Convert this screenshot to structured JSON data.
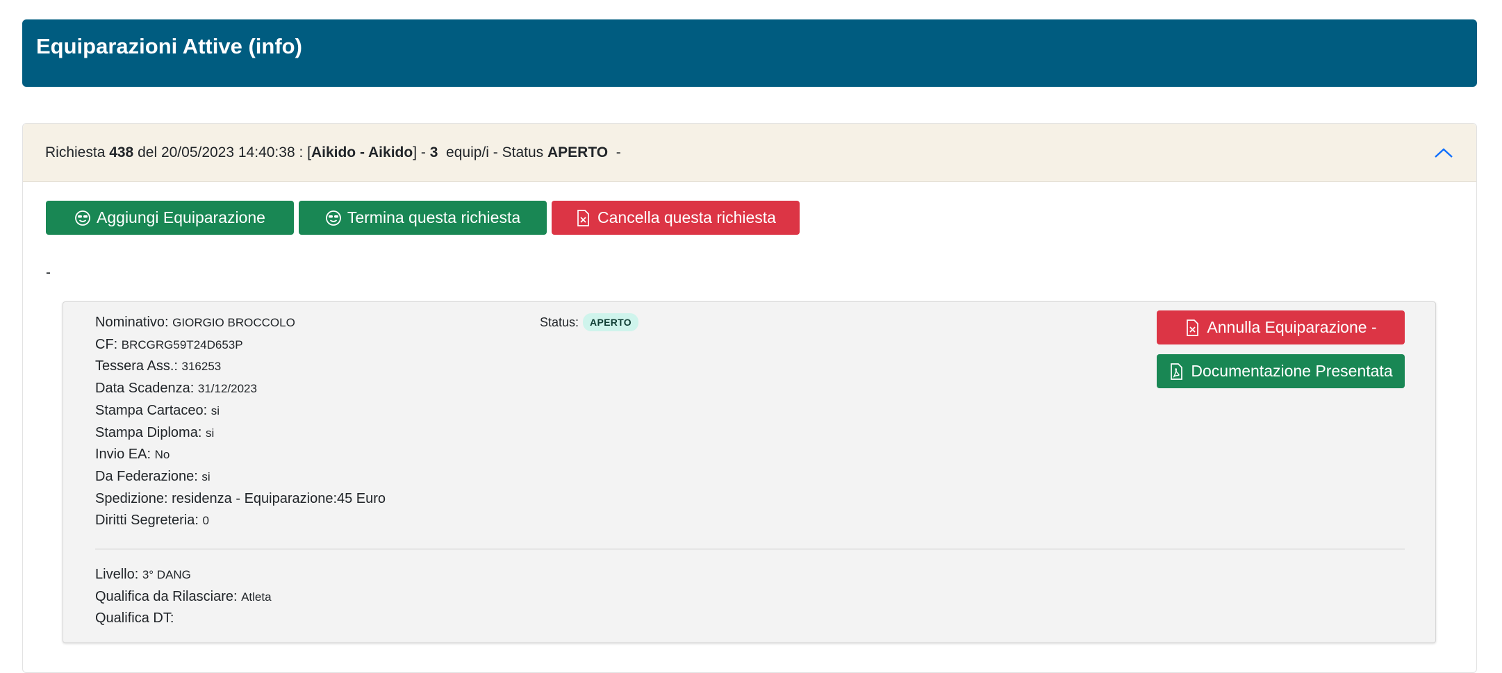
{
  "header": {
    "title": "Equiparazioni Attive (info)"
  },
  "request": {
    "prefix": "Richiesta ",
    "number": "438",
    "date_text": " del 20/05/2023 14:40:38 : [",
    "discipline": "Aikido - Aikido",
    "after_discipline": "] - ",
    "count": "3",
    "count_suffix": "  equip/i - Status ",
    "status": "APERTO",
    "trailing": "  -"
  },
  "actions": {
    "add_label": "Aggiungi Equiparazione",
    "end_label": "Termina questa richiesta",
    "cancel_label": "Cancella questa richiesta"
  },
  "note": "-",
  "card": {
    "fields": [
      {
        "label": "Nominativo: ",
        "value": "GIORGIO BROCCOLO"
      },
      {
        "label": "CF: ",
        "value": "BRCGRG59T24D653P"
      },
      {
        "label": "Tessera Ass.: ",
        "value": "316253"
      },
      {
        "label": "Data Scadenza: ",
        "value": "31/12/2023"
      },
      {
        "label": "Stampa Cartaceo: ",
        "value": "si"
      },
      {
        "label": "Stampa Diploma: ",
        "value": "si"
      },
      {
        "label": "Invio EA: ",
        "value": "No"
      },
      {
        "label": "Da Federazione: ",
        "value": "si"
      }
    ],
    "spedizione": "Spedizione: residenza - Equiparazione:45 Euro",
    "diritti": {
      "label": "Diritti Segreteria: ",
      "value": "0"
    },
    "status_label": "Status:",
    "status_value": "APERTO",
    "annulla_label": "Annulla Equiparazione -",
    "doc_label": "Documentazione Presentata",
    "fields2": [
      {
        "label": "Livello: ",
        "value": "3° DANG"
      },
      {
        "label": "Qualifica da Rilasciare: ",
        "value": "Atleta"
      },
      {
        "label": "Qualifica DT: ",
        "value": ""
      }
    ]
  },
  "colors": {
    "header_bg": "#005c80",
    "accordion_head_bg": "#f6f1e6",
    "success": "#198754",
    "danger": "#dc3545",
    "badge_bg": "#cff4ec",
    "link_blue": "#0d6efd"
  },
  "icons": {
    "add": "smiley-sunglasses-icon",
    "end": "smiley-sunglasses-icon",
    "cancel": "file-x-icon",
    "annulla": "file-x-icon",
    "doc": "file-pdf-icon",
    "collapse": "chevron-up-icon"
  }
}
